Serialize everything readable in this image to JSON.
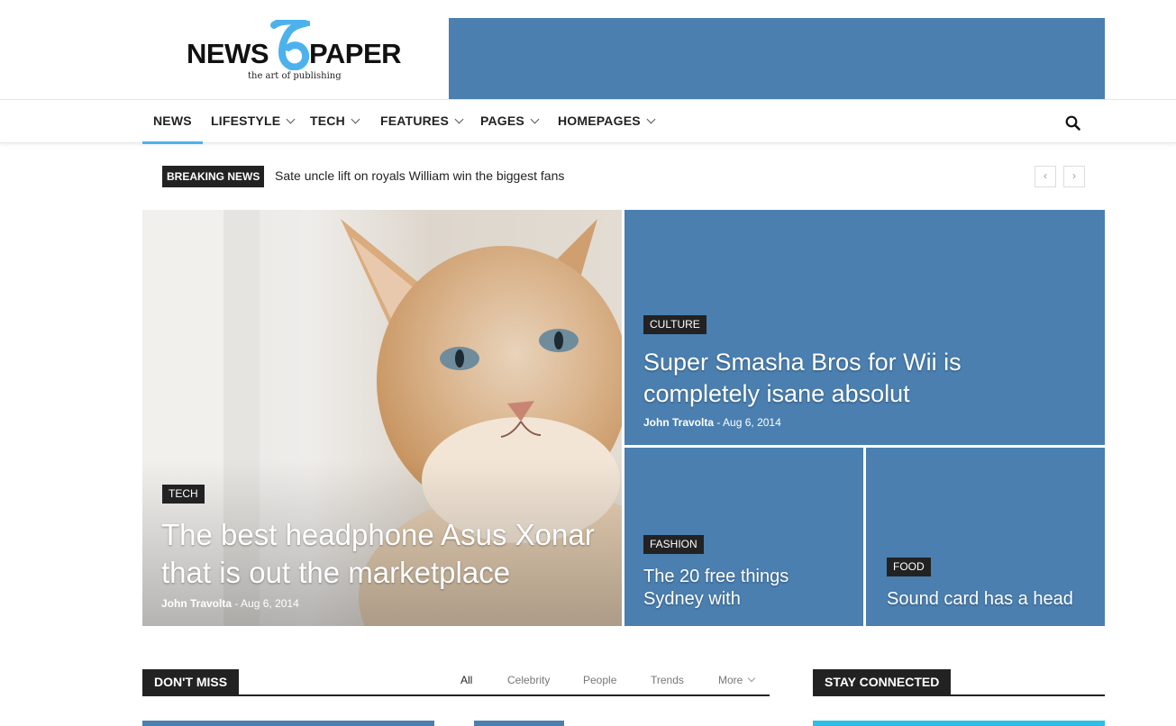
{
  "header": {
    "logo": {
      "word_left": "NEWS",
      "word_right": "PAPER",
      "digit": "6",
      "tagline": "the art of publishing"
    },
    "colors": {
      "accent": "#4db2ec",
      "banner": "#4a7fb0",
      "dark": "#222222"
    }
  },
  "nav": {
    "items": [
      {
        "label": "NEWS",
        "has_menu": false
      },
      {
        "label": "LIFESTYLE",
        "has_menu": true
      },
      {
        "label": "TECH",
        "has_menu": true
      },
      {
        "label": "FEATURES",
        "has_menu": true
      },
      {
        "label": "PAGES",
        "has_menu": true
      },
      {
        "label": "HOMEPAGES",
        "has_menu": true
      }
    ],
    "search_icon": "search-icon"
  },
  "breaking": {
    "label": "BREAKING NEWS",
    "text": "Sate uncle lift on royals William win the biggest fans",
    "prev": "‹",
    "next": "›"
  },
  "featured": [
    {
      "category": "TECH",
      "title": "The best headphone Asus Xonar that is out the marketplace",
      "author": "John Travolta",
      "date": "Aug 6, 2014"
    },
    {
      "category": "CULTURE",
      "title": "Super Smasha Bros for Wii is completely isane absolut",
      "author": "John Travolta",
      "date": "Aug 6, 2014"
    },
    {
      "category": "FASHION",
      "title": "The 20 free things Sydney with"
    },
    {
      "category": "FOOD",
      "title": "Sound card has a head"
    }
  ],
  "dont_miss": {
    "title": "DON'T MISS",
    "filters": [
      "All",
      "Celebrity",
      "People",
      "Trends",
      "More"
    ]
  },
  "stay_connected": {
    "title": "STAY CONNECTED"
  }
}
